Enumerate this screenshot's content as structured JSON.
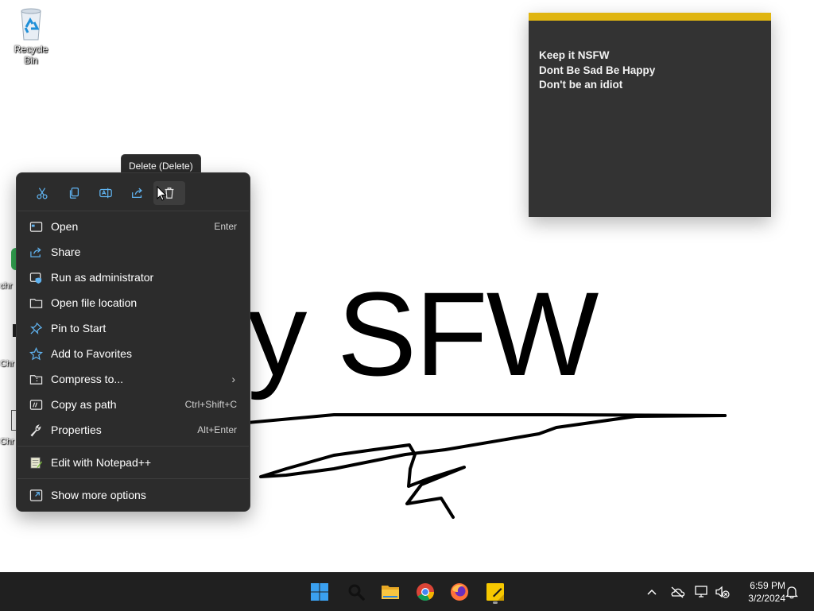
{
  "desktop": {
    "recycle_bin_label": "Recycle Bin",
    "partial_icon_labels": [
      "chr",
      "Chr",
      "Chr"
    ],
    "wallpaper_text": "ay SFW"
  },
  "sticky_note": {
    "accent_color": "#e0b510",
    "lines": [
      "Keep it NSFW",
      "Dont Be Sad Be Happy",
      "Don't be an idiot"
    ]
  },
  "tooltip": {
    "text": "Delete (Delete)"
  },
  "context_menu": {
    "quick_actions": [
      {
        "name": "cut-icon",
        "label": "Cut"
      },
      {
        "name": "copy-icon",
        "label": "Copy"
      },
      {
        "name": "rename-icon",
        "label": "Rename"
      },
      {
        "name": "share-icon",
        "label": "Share"
      },
      {
        "name": "delete-icon",
        "label": "Delete"
      }
    ],
    "items": [
      {
        "label": "Open",
        "shortcut": "Enter",
        "icon": "open-app-icon"
      },
      {
        "label": "Share",
        "shortcut": "",
        "icon": "share-icon"
      },
      {
        "label": "Run as administrator",
        "shortcut": "",
        "icon": "shield-icon"
      },
      {
        "label": "Open file location",
        "shortcut": "",
        "icon": "folder-icon"
      },
      {
        "label": "Pin to Start",
        "shortcut": "",
        "icon": "pin-icon"
      },
      {
        "label": "Add to Favorites",
        "shortcut": "",
        "icon": "star-icon"
      },
      {
        "label": "Compress to...",
        "shortcut": "",
        "icon": "zip-folder-icon",
        "submenu": true
      },
      {
        "label": "Copy as path",
        "shortcut": "Ctrl+Shift+C",
        "icon": "copy-path-icon"
      },
      {
        "label": "Properties",
        "shortcut": "Alt+Enter",
        "icon": "wrench-icon"
      },
      {
        "label": "Edit with Notepad++",
        "shortcut": "",
        "icon": "notepadpp-icon"
      },
      {
        "label": "Show more options",
        "shortcut": "",
        "icon": "more-options-icon"
      }
    ],
    "submenu_glyph": "›"
  },
  "taskbar": {
    "apps": [
      "start-icon",
      "search-icon",
      "file-explorer-icon",
      "chrome-icon",
      "firefox-icon",
      "sticky-notes-icon"
    ],
    "tray": [
      "chevron-up-icon",
      "onedrive-icon",
      "network-icon",
      "volume-muted-icon",
      "notification-icon"
    ],
    "time": "6:59 PM",
    "date": "3/2/2024"
  }
}
